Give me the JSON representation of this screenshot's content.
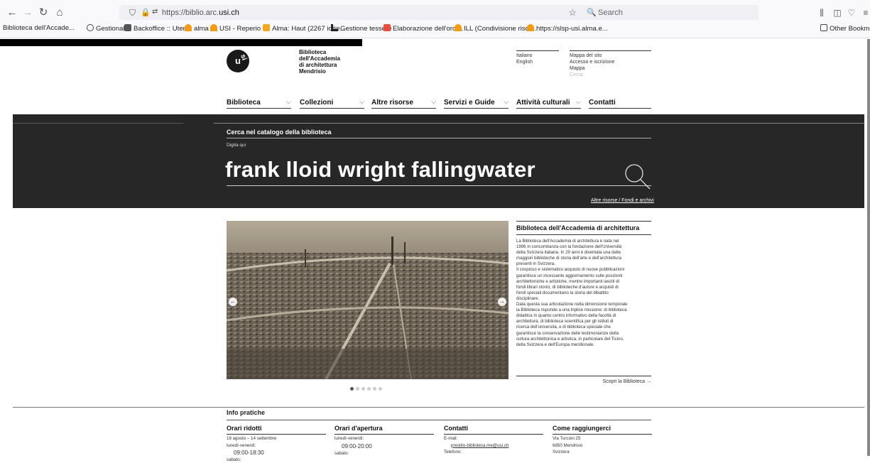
{
  "browser": {
    "url_prefix": "https://biblio.arc.",
    "url_domain": "usi.ch",
    "search_placeholder": "Search",
    "bookmarks": [
      "Biblioteca dell'Accade...",
      "Gestionale",
      "Backoffice :: Utenti",
      "alma",
      "USI - Reperio",
      "Alma: Haut (2267 idée...",
      "Gestione tessere",
      "Elaborazione dell'ordi...",
      "ILL (Condivisione risor...",
      "https://slsp-usi.alma.e..."
    ],
    "other_bookmarks": "Other Bookmarks"
  },
  "header": {
    "logo_text": "u",
    "logo_sub": "si",
    "institution": [
      "Biblioteca",
      "dell'Accademia",
      "di architettura",
      "Mendrisio"
    ],
    "languages": [
      "Italiano",
      "English"
    ],
    "sitelinks": [
      "Mappa del sito",
      "Accesso e iscrizione",
      "Mappa",
      "Cerca"
    ]
  },
  "nav": [
    {
      "label": "Biblioteca"
    },
    {
      "label": "Collezioni"
    },
    {
      "label": "Altre risorse"
    },
    {
      "label": "Servizi e Guide"
    },
    {
      "label": "Attività culturali"
    },
    {
      "label": "Contatti"
    }
  ],
  "search": {
    "title": "Cerca nel catalogo della biblioteca",
    "hint": "Digita qui",
    "query": "frank lloid wright fallingwater",
    "link_altre": "Altre risorse",
    "link_sep": " / ",
    "link_fondi": "Fondi e archivi"
  },
  "about": {
    "title": "Biblioteca dell'Accademia di architettura",
    "body": "La Biblioteca dell'Accademia di architettura è nata nel\n1996 in concomitanza con la fondazione dell'Università\ndella Svizzera italiana. In 29 anni è diventata una delle\nmaggiori biblioteche di storia dell'arte e dell'architettura\npresenti in Svizzera.\nIl cospicuo e sistematico acquisto di nuove pubblicazioni\ngarantisce un incessante aggiornamento sulle posizioni\narchitettoniche e artistiche, mentre importanti lasciti di\nfondi librari storici, di biblioteche d'autore e acquisti di\nfondi speciali documentano la storia del dibattito\ndisciplinare.\nData questa sua articolazione nella dimensione temporale\nla Biblioteca risponde a una triplice missione: di biblioteca\ndidattica in quanto centro informativo della facoltà di\narchitettura, di biblioteca scientifica per gli istituti di\nricerca dell'università, e di biblioteca speciale che\ngarantisce la conservazione delle testimonianze della\ncultura architettonica e artistica, in particolare del Ticino,\ndella Svizzera e dell'Europa meridionale.",
    "more": "Scopri la Biblioteca →"
  },
  "info": {
    "title": "Info pratiche",
    "col1": {
      "title": "Orari ridotti",
      "l1": "18 agosto – 14 settembre",
      "l2": "lunedì-venerdì:",
      "l3": "09:00-18:30",
      "l4": "sabato:"
    },
    "col2": {
      "title": "Orari d'apertura",
      "l1": "lunedì-venerdì:",
      "l2": "09:00-20:00",
      "l3": "sabato:"
    },
    "col3": {
      "title": "Contatti",
      "l1": "E-mail:",
      "l2": "prestito-biblioteca.me@usi.ch",
      "l3": "Telefono:"
    },
    "col4": {
      "title": "Come raggiungerci",
      "l1": "Via Turconi 25",
      "l2": "6850 Mendrisio",
      "l3": "Svizzera"
    }
  },
  "gallery": {
    "slides": 6,
    "active": 1
  }
}
